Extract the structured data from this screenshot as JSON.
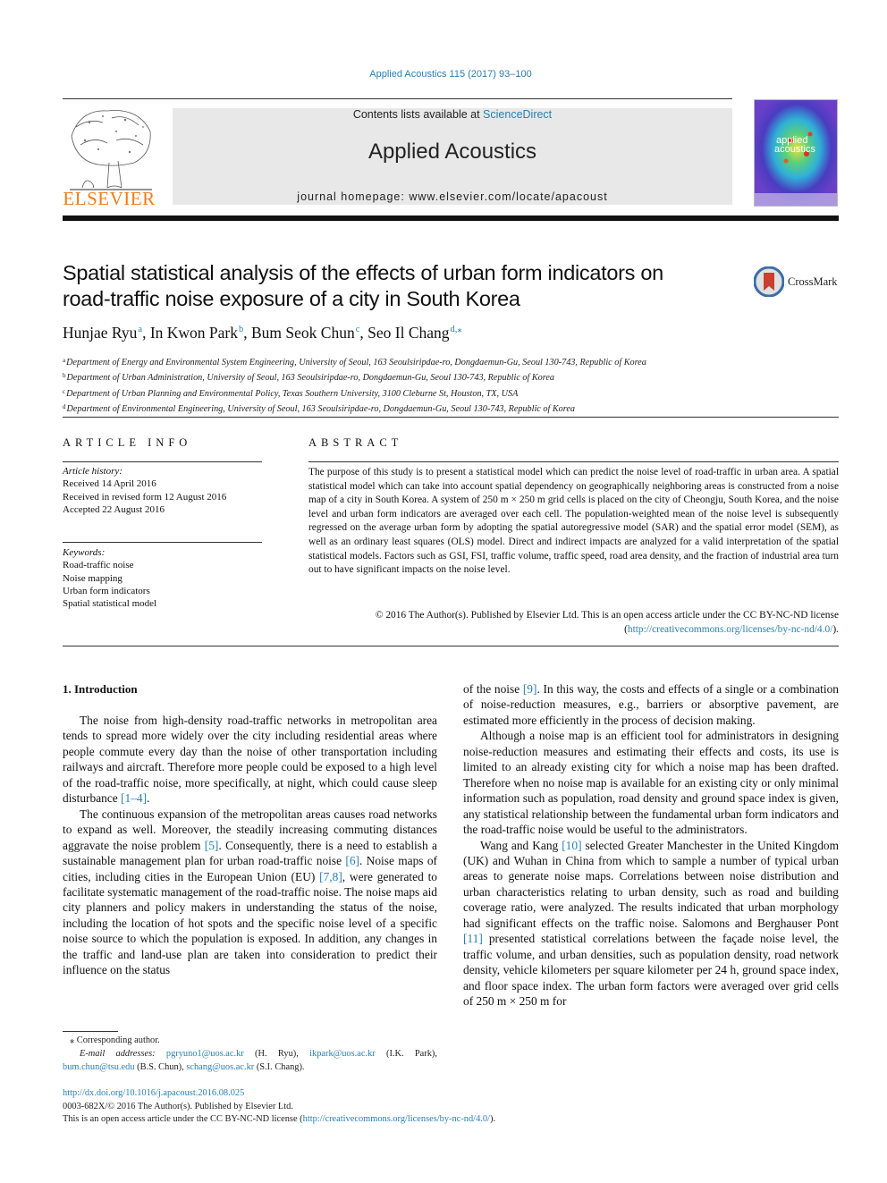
{
  "header": {
    "journal_ref": "Applied Acoustics 115 (2017) 93–100",
    "contents_prefix": "Contents lists available at ",
    "contents_link": "ScienceDirect",
    "journal_name": "Applied Acoustics",
    "homepage_prefix": "journal homepage: ",
    "homepage_url": "www.elsevier.com/locate/apacoust",
    "publisher_logo": "ELSEVIER",
    "cover_text_line1": "applied",
    "cover_text_line2": "acoustics",
    "crossmark_label": "CrossMark"
  },
  "article": {
    "title_line1": "Spatial statistical analysis of the effects of urban form indicators on",
    "title_line2": "road-traffic noise exposure of a city in South Korea",
    "authors": [
      {
        "name": "Hunjae Ryu",
        "sup": "a",
        "sep": ", "
      },
      {
        "name": "In Kwon Park",
        "sup": "b",
        "sep": ", "
      },
      {
        "name": "Bum Seok Chun",
        "sup": "c",
        "sep": ", "
      },
      {
        "name": "Seo Il Chang",
        "sup": "d,⁎",
        "sep": ""
      }
    ],
    "affiliations": [
      {
        "key": "a",
        "text": "Department of Energy and Environmental System Engineering, University of Seoul, 163 Seoulsiripdae-ro, Dongdaemun-Gu, Seoul 130-743, Republic of Korea"
      },
      {
        "key": "b",
        "text": "Department of Urban Administration, University of Seoul, 163 Seoulsiripdae-ro, Dongdaemun-Gu, Seoul 130-743, Republic of Korea"
      },
      {
        "key": "c",
        "text": "Department of Urban Planning and Environmental Policy, Texas Southern University, 3100 Cleburne St, Houston, TX, USA"
      },
      {
        "key": "d",
        "text": "Department of Environmental Engineering, University of Seoul, 163 Seoulsiripdae-ro, Dongdaemun-Gu, Seoul 130-743, Republic of Korea"
      }
    ]
  },
  "article_info": {
    "heading": "ARTICLE INFO",
    "history_label": "Article history:",
    "history": [
      "Received 14 April 2016",
      "Received in revised form 12 August 2016",
      "Accepted 22 August 2016"
    ],
    "keywords_label": "Keywords:",
    "keywords": [
      "Road-traffic noise",
      "Noise mapping",
      "Urban form indicators",
      "Spatial statistical model"
    ]
  },
  "abstract": {
    "heading": "ABSTRACT",
    "text": "The purpose of this study is to present a statistical model which can predict the noise level of road-traffic in urban area. A spatial statistical model which can take into account spatial dependency on geographically neighboring areas is constructed from a noise map of a city in South Korea. A system of 250 m × 250 m grid cells is placed on the city of Cheongju, South Korea, and the noise level and urban form indicators are averaged over each cell. The population-weighted mean of the noise level is subsequently regressed on the average urban form by adopting the spatial autoregressive model (SAR) and the spatial error model (SEM), as well as an ordinary least squares (OLS) model. Direct and indirect impacts are analyzed for a valid interpretation of the spatial statistical models. Factors such as GSI, FSI, traffic volume, traffic speed, road area density, and the fraction of industrial area turn out to have significant impacts on the noise level.",
    "copyright_prefix": "© 2016 The Author(s). Published by Elsevier Ltd. This is an open access article under the CC BY-NC-ND license (",
    "license_link": "http://creativecommons.org/licenses/by-nc-nd/4.0/",
    "copyright_suffix": ")."
  },
  "body": {
    "section_heading": "1. Introduction",
    "left_p1_a": "The noise from high-density road-traffic networks in metropolitan area tends to spread more widely over the city including residential areas where people commute every day than the noise of other transportation including railways and aircraft. Therefore more people could be exposed to a high level of the road-traffic noise, more specifically, at night, which could cause sleep disturbance ",
    "left_p1_ref": "[1–4]",
    "left_p1_b": ".",
    "left_p2_a": "The continuous expansion of the metropolitan areas causes road networks to expand as well. Moreover, the steadily increasing commuting distances aggravate the noise problem ",
    "left_p2_ref1": "[5]",
    "left_p2_b": ". Consequently, there is a need to establish a sustainable management plan for urban road-traffic noise ",
    "left_p2_ref2": "[6]",
    "left_p2_c": ". Noise maps of cities, including cities in the European Union (EU) ",
    "left_p2_ref3": "[7,8]",
    "left_p2_d": ", were generated to facilitate systematic management of the road-traffic noise. The noise maps aid city planners and policy makers in understanding the status of the noise, including the location of hot spots and the specific noise level of a specific noise source to which the population is exposed. In addition, any changes in the traffic and land-use plan are taken into consideration to predict their influence on the status",
    "right_p1_a": "of the noise ",
    "right_p1_ref": "[9]",
    "right_p1_b": ". In this way, the costs and effects of a single or a combination of noise-reduction measures, e.g., barriers or absorptive pavement, are estimated more efficiently in the process of decision making.",
    "right_p2": "Although a noise map is an efficient tool for administrators in designing noise-reduction measures and estimating their effects and costs, its use is limited to an already existing city for which a noise map has been drafted. Therefore when no noise map is available for an existing city or only minimal information such as population, road density and ground space index is given, any statistical relationship between the fundamental urban form indicators and the road-traffic noise would be useful to the administrators.",
    "right_p3_a": "Wang and Kang ",
    "right_p3_ref1": "[10]",
    "right_p3_b": " selected Greater Manchester in the United Kingdom (UK) and Wuhan in China from which to sample a number of typical urban areas to generate noise maps. Correlations between noise distribution and urban characteristics relating to urban density, such as road and building coverage ratio, were analyzed. The results indicated that urban morphology had significant effects on the traffic noise. Salomons and Berghauser Pont ",
    "right_p3_ref2": "[11]",
    "right_p3_c": " presented statistical correlations between the façade noise level, the traffic volume, and urban densities, such as population density, road network density, vehicle kilometers per square kilometer per 24 h, ground space index, and floor space index. The urban form factors were averaged over grid cells of 250 m × 250 m for"
  },
  "footnote": {
    "corresponding": "⁎ Corresponding author.",
    "email_label": "E-mail addresses: ",
    "emails": [
      {
        "addr": "pgryuno1@uos.ac.kr",
        "who": " (H. Ryu), "
      },
      {
        "addr": "ikpark@uos.ac.kr",
        "who": " (I.K. Park), "
      },
      {
        "addr": "bum.chun@tsu.edu",
        "who": " (B.S. Chun), "
      },
      {
        "addr": "schang@uos.ac.kr",
        "who": " (S.I. Chang)."
      }
    ]
  },
  "footer": {
    "doi": "http://dx.doi.org/10.1016/j.apacoust.2016.08.025",
    "issn_line": "0003-682X/© 2016 The Author(s). Published by Elsevier Ltd.",
    "license_prefix": "This is an open access article under the CC BY-NC-ND license (",
    "license_link": "http://creativecommons.org/licenses/by-nc-nd/4.0/",
    "license_suffix": ")."
  },
  "colors": {
    "link": "#2a7fb0",
    "elsevier_orange": "#f07d18",
    "banner_gray": "#e8e8e8"
  }
}
